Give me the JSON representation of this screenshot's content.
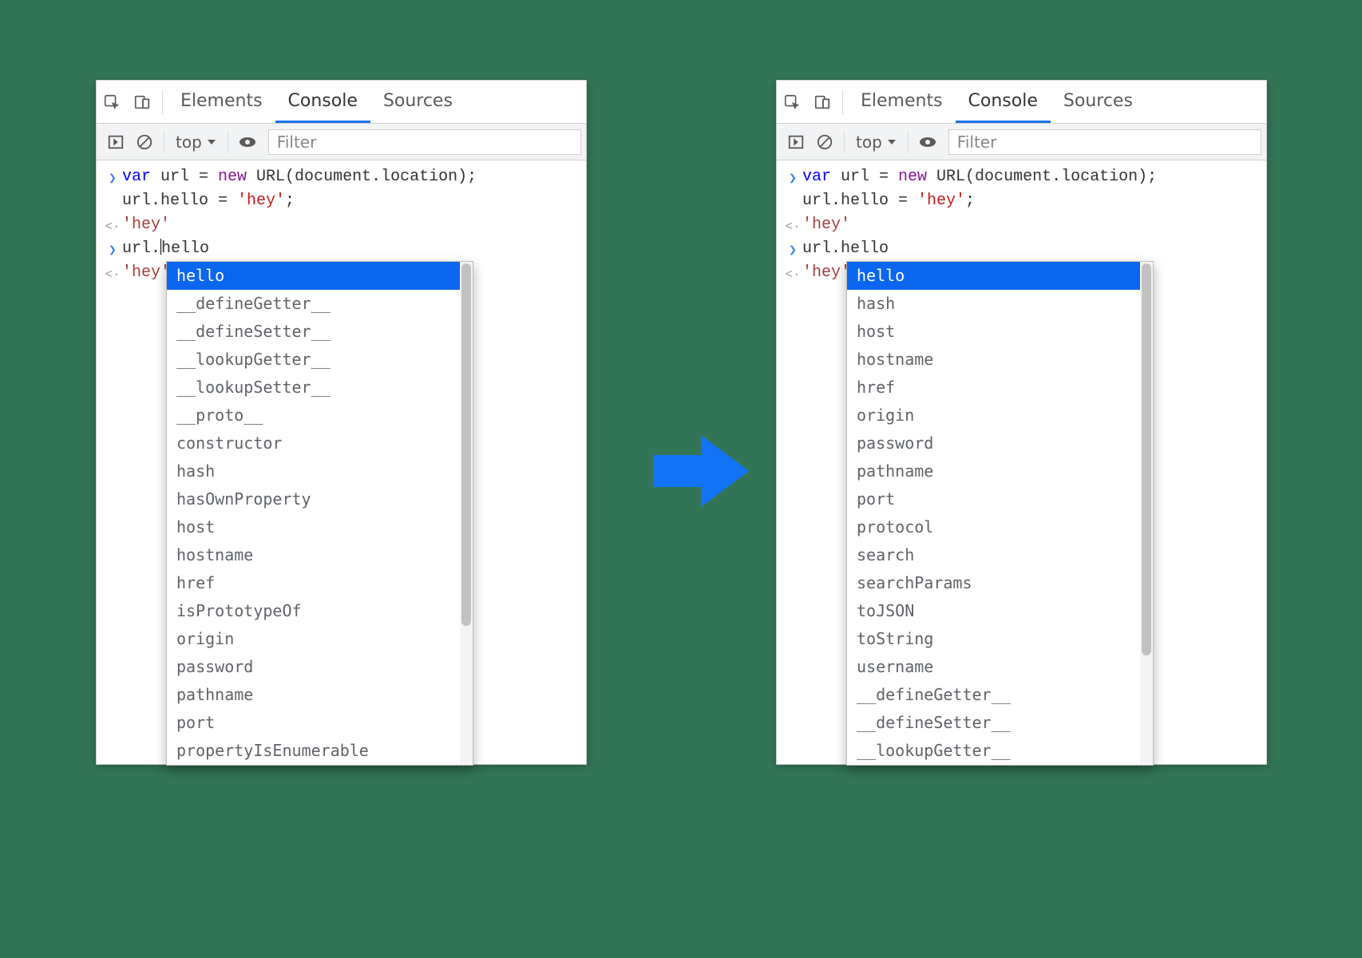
{
  "tabs": {
    "elements": "Elements",
    "console": "Console",
    "sources": "Sources"
  },
  "tool": {
    "context": "top",
    "filter_placeholder": "Filter"
  },
  "code": {
    "line1a": "var",
    "line1b": " url = ",
    "line1c": "new",
    "line1d": " URL(document.location);",
    "line2": "url.hello = ",
    "line2s": "'hey'",
    "line2e": ";",
    "out1": "'hey'",
    "line3a": "url.",
    "line3b_left": "hello",
    "line3b_right": "hello",
    "out2": "'hey'"
  },
  "ac_left": [
    "hello",
    "__defineGetter__",
    "__defineSetter__",
    "__lookupGetter__",
    "__lookupSetter__",
    "__proto__",
    "constructor",
    "hash",
    "hasOwnProperty",
    "host",
    "hostname",
    "href",
    "isPrototypeOf",
    "origin",
    "password",
    "pathname",
    "port",
    "propertyIsEnumerable"
  ],
  "ac_right": [
    "hello",
    "hash",
    "host",
    "hostname",
    "href",
    "origin",
    "password",
    "pathname",
    "port",
    "protocol",
    "search",
    "searchParams",
    "toJSON",
    "toString",
    "username",
    "__defineGetter__",
    "__defineSetter__",
    "__lookupGetter__"
  ]
}
